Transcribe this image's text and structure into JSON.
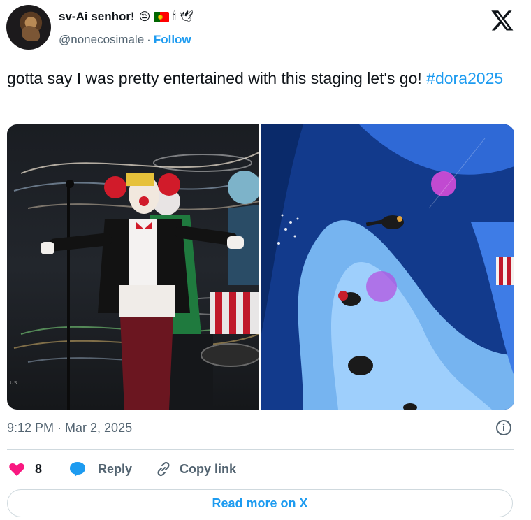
{
  "author": {
    "display_name": "sv-Ai senhor!",
    "handle": "@nonecosimale",
    "separator": "·",
    "follow_label": "Follow",
    "emojis": [
      "😔",
      "portugal-flag",
      "🕯",
      "🕊"
    ]
  },
  "tweet": {
    "text": "gotta say I was pretty entertained with this staging let's go! ",
    "hashtag": "#dora2025"
  },
  "media": {
    "count": 2,
    "watermark_left": "us"
  },
  "meta": {
    "timestamp": "9:12 PM · Mar 2, 2025"
  },
  "actions": {
    "like_count": "8",
    "reply_label": "Reply",
    "copy_link_label": "Copy link"
  },
  "cta": {
    "read_more_label": "Read more on X"
  },
  "colors": {
    "accent": "#1d9bf0",
    "like": "#f91880",
    "muted": "#536471",
    "text": "#0f1419",
    "border": "#cfd9de"
  }
}
